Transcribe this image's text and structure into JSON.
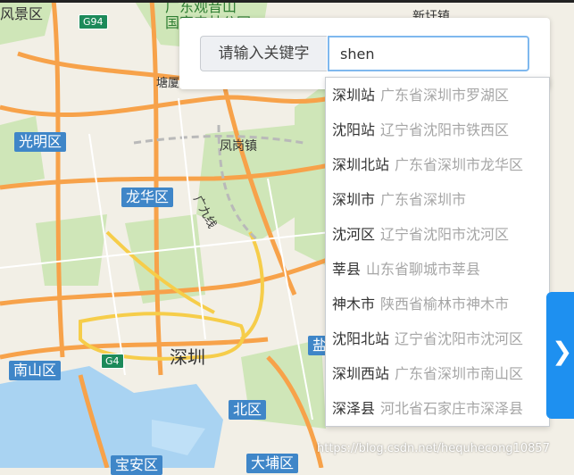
{
  "search": {
    "label": "请输入关键字",
    "value": "shen"
  },
  "suggestions": [
    {
      "name": "深圳站",
      "address": "广东省深圳市罗湖区"
    },
    {
      "name": "沈阳站",
      "address": "辽宁省沈阳市铁西区"
    },
    {
      "name": "深圳北站",
      "address": "广东省深圳市龙华区"
    },
    {
      "name": "深圳市",
      "address": "广东省深圳市"
    },
    {
      "name": "沈河区",
      "address": "辽宁省沈阳市沈河区"
    },
    {
      "name": "莘县",
      "address": "山东省聊城市莘县"
    },
    {
      "name": "神木市",
      "address": "陕西省榆林市神木市"
    },
    {
      "name": "沈阳北站",
      "address": "辽宁省沈阳市沈河区"
    },
    {
      "name": "深圳西站",
      "address": "广东省深圳市南山区"
    },
    {
      "name": "深泽县",
      "address": "河北省石家庄市深泽县"
    }
  ],
  "map": {
    "labels": {
      "top_left": "风景区",
      "guangming": "光明区",
      "longhua": "龙华区",
      "nanshan": "南山区",
      "shenzhen": "深圳",
      "tangxia": "塘厦",
      "fenggang": "凤岗镇",
      "xinxu": "新圩镇",
      "beiqu": "北区",
      "dapeng": "大埔区",
      "qianhai": "宝安区",
      "yan": "盐",
      "railway": "广九线",
      "park": "国家森林公园",
      "park_top": "广东观音山"
    },
    "shields": {
      "g94": "G94",
      "g4": "G4"
    }
  },
  "side_tab": {
    "icon": "❯"
  },
  "watermark": "https://blog.csdn.net/hequhecong10857"
}
